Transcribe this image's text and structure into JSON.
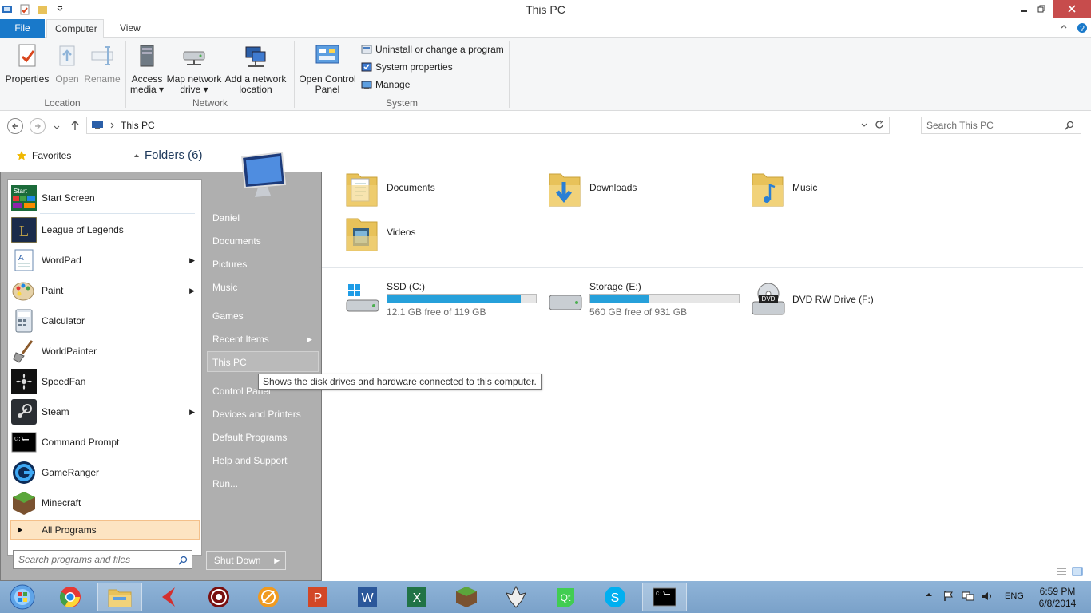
{
  "window": {
    "title": "This PC"
  },
  "ribbon_tabs": {
    "file": "File",
    "computer": "Computer",
    "view": "View"
  },
  "ribbon": {
    "location": {
      "label": "Location",
      "properties": "Properties",
      "open": "Open",
      "rename": "Rename"
    },
    "network": {
      "label": "Network",
      "access_media": [
        "Access",
        "media ▾"
      ],
      "map_drive": [
        "Map network",
        "drive ▾"
      ],
      "add_location": [
        "Add a network",
        "location"
      ]
    },
    "system": {
      "label": "System",
      "open_cp": [
        "Open Control",
        "Panel"
      ],
      "uninstall": "Uninstall or change a program",
      "sys_props": "System properties",
      "manage": "Manage"
    }
  },
  "address": {
    "crumb": "This PC",
    "search_placeholder": "Search This PC"
  },
  "nav": {
    "favorites": "Favorites"
  },
  "content": {
    "folders_heading": "Folders (6)",
    "folders": [
      "Documents",
      "Downloads",
      "Music",
      "Videos"
    ],
    "drives": [
      {
        "name": "SSD (C:)",
        "free": "12.1 GB free of 119 GB",
        "used_fraction": 0.9
      },
      {
        "name": "Storage (E:)",
        "free": "560 GB free of 931 GB",
        "used_fraction": 0.4
      }
    ],
    "dvd": "DVD RW Drive (F:)"
  },
  "start_menu": {
    "programs": [
      {
        "name": "Start Screen",
        "icon": "start-screen-icon"
      },
      {
        "name": "League of Legends",
        "icon": "league-icon"
      },
      {
        "name": "WordPad",
        "icon": "wordpad-icon",
        "submenu": true
      },
      {
        "name": "Paint",
        "icon": "paint-icon",
        "submenu": true
      },
      {
        "name": "Calculator",
        "icon": "calculator-icon"
      },
      {
        "name": "WorldPainter",
        "icon": "worldpainter-icon"
      },
      {
        "name": "SpeedFan",
        "icon": "speedfan-icon"
      },
      {
        "name": "Steam",
        "icon": "steam-icon",
        "submenu": true
      },
      {
        "name": "Command Prompt",
        "icon": "cmd-icon"
      },
      {
        "name": "GameRanger",
        "icon": "gameranger-icon"
      },
      {
        "name": "Minecraft",
        "icon": "minecraft-icon"
      }
    ],
    "all_programs": "All Programs",
    "search_placeholder": "Search programs and files",
    "right": [
      "Daniel",
      "Documents",
      "Pictures",
      "Music",
      "Games",
      "Recent Items",
      "This PC",
      "Control Panel",
      "Devices and Printers",
      "Default Programs",
      "Help and Support",
      "Run..."
    ],
    "shutdown": "Shut Down"
  },
  "tooltip": "Shows the disk drives and hardware connected to this computer.",
  "tray": {
    "lang": "ENG",
    "time": "6:59 PM",
    "date": "6/8/2014"
  },
  "colors": {
    "accent": "#1979ca",
    "drive_bar": "#26a0da",
    "highlight": "#fde4c2"
  }
}
